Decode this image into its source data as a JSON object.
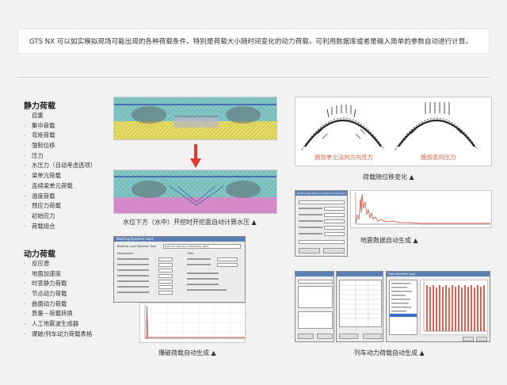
{
  "intro": "GTS NX 可以如实模拟现场可能出现的各种荷载条件。特别是荷载大小随时间变化的动力荷载，可利用数据库或者是输入简单的参数自动进行计算。",
  "static_section": {
    "title": "静力荷载",
    "items": [
      "自重",
      "集中荷载",
      "弯矩荷载",
      "强制位移",
      "压力",
      "水压力（自动考虑选项）",
      "梁单元荷载",
      "连续梁单元荷载",
      "温度荷载",
      "预应力荷载",
      "初始应力",
      "荷载组合"
    ]
  },
  "dynamic_section": {
    "title": "动力荷载",
    "items": [
      "反应谱",
      "地面加速度",
      "时变静力荷载",
      "节点动力荷载",
      "曲面动力荷载",
      "质量－荷载转换",
      "人工地震波生成器",
      "爆破/列车动力荷载表格"
    ]
  },
  "captions": {
    "water": "水位下方（水中）开挖时开挖面自动计算水压 ▲",
    "load_follow": "荷载随位移变化 ▲",
    "seismic": "地震数据自动生成 ▲",
    "blast": "爆破荷载自动生成 ▲",
    "train": "列车动力荷载自动生成 ▲"
  },
  "arch_labels": {
    "left": "施加单元法向方向压力",
    "right": "施加竖向压力"
  },
  "blast_dialog": {
    "title": "Blasting Dynamic Load",
    "eq_label": "Blasting Load Equation Type",
    "eq_value": "National Highway Institute(US)_(NHI)",
    "params_header": "Parameters",
    "time_header": "Time"
  },
  "seismic_dialog": {
    "title": "Earthquake Response Spectra Generator"
  },
  "train_dialog": {
    "title": "Train Dynamic Load"
  },
  "colors": {
    "caption_red": "#e05a3a",
    "arrow_red": "#e23b2b"
  }
}
